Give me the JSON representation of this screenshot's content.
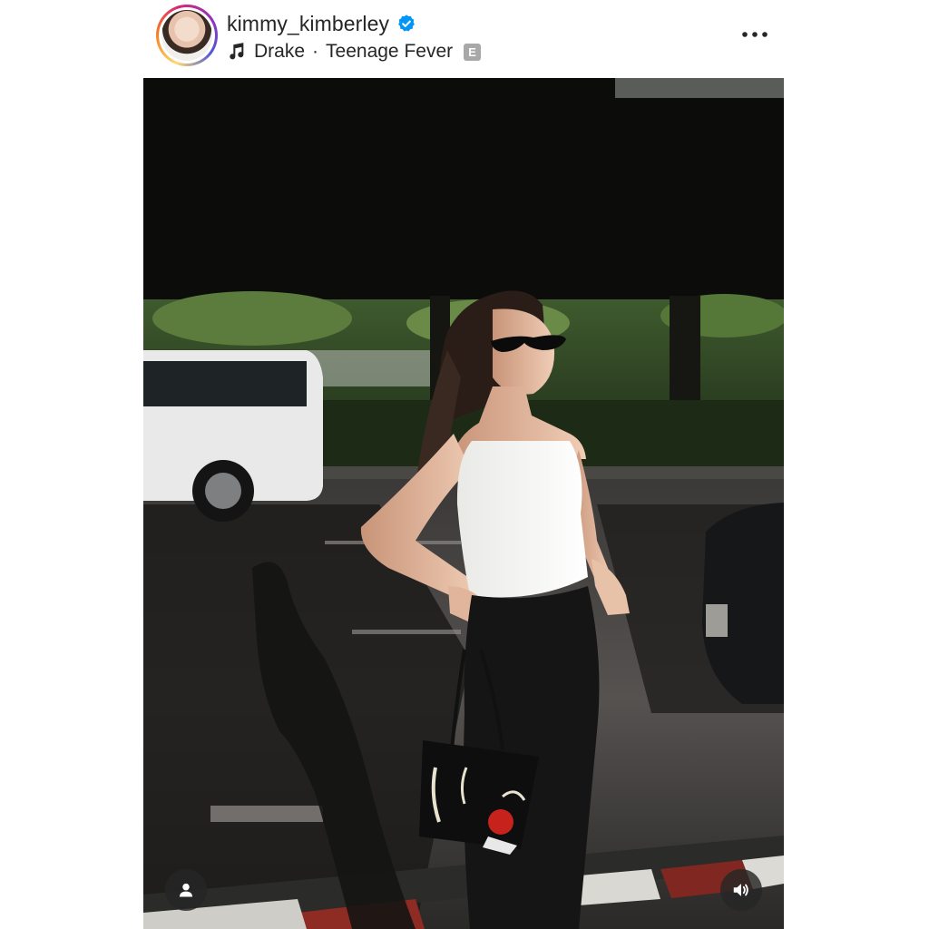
{
  "post": {
    "username": "kimmy_kimberley",
    "verified": true,
    "music": {
      "artist": "Drake",
      "separator": "·",
      "track": "Teenage Fever",
      "explicit_badge": "E"
    }
  },
  "icons": {
    "verified": "verified-badge-icon",
    "music": "music-note-icon",
    "more": "more-options-icon",
    "tag": "user-tag-icon",
    "audio": "speaker-icon"
  },
  "colors": {
    "text": "#262626",
    "verified_blue": "#0095f6",
    "badge_gray": "#a8a8a8",
    "overlay_button": "#262626"
  }
}
